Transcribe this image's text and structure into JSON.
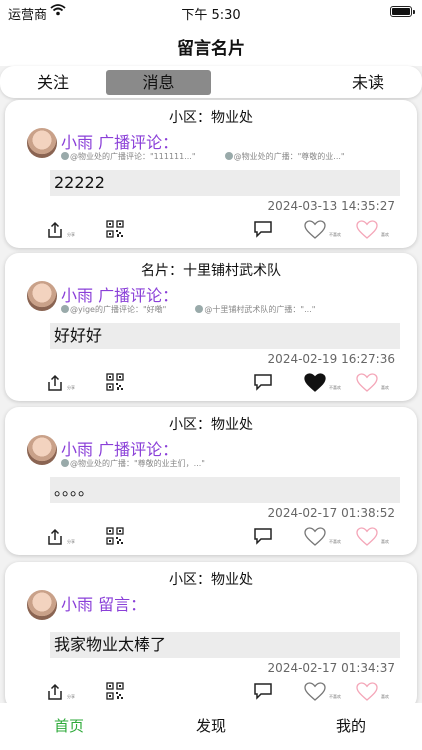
{
  "status_bar": {
    "carrier": "运营商",
    "time": "下午 5:30",
    "wifi_icon": "wifi-icon",
    "battery_icon": "battery-icon"
  },
  "nav": {
    "title": "留言名片"
  },
  "segments": {
    "follow": "关注",
    "messages": "消息",
    "unread": "未读",
    "selected": "消息"
  },
  "cards": [
    {
      "title": "小区：物业处",
      "author": "小雨 广播评论：",
      "quote_left": "@物业处的广播评论：\"111111...\"",
      "quote_right": "@物业处的广播：\"尊敬的业...\"",
      "content": "22222",
      "timestamp": "2024-03-13 14:35:27",
      "share_label": "分享",
      "like_label": "不喜欢",
      "fav_label": "喜欢",
      "liked": false
    },
    {
      "title": "名片：十里铺村武术队",
      "author": "小雨 广播评论：",
      "quote_left": "@yige的广播评论：\"好嘞\"",
      "quote_right": "@十里铺村武术队的广播：\"...\"",
      "content": "好好好",
      "timestamp": "2024-02-19 16:27:36",
      "share_label": "分享",
      "like_label": "不喜欢",
      "fav_label": "喜欢",
      "liked": true
    },
    {
      "title": "小区：物业处",
      "author": "小雨 广播评论：",
      "quote_left": "@物业处的广播：\"尊敬的业主们，...\"",
      "quote_right": "",
      "content": "。。。。",
      "timestamp": "2024-02-17 01:38:52",
      "share_label": "分享",
      "like_label": "不喜欢",
      "fav_label": "喜欢",
      "liked": false
    },
    {
      "title": "小区：物业处",
      "author": "小雨 留言：",
      "quote_left": "",
      "quote_right": "",
      "content": "我家物业太棒了",
      "timestamp": "2024-02-17 01:34:37",
      "share_label": "分享",
      "like_label": "不喜欢",
      "fav_label": "喜欢",
      "liked": false
    }
  ],
  "tabs": {
    "home": "首页",
    "discover": "发现",
    "mine": "我的",
    "active": "首页"
  },
  "colors": {
    "accent_green": "#2eaa3a",
    "author_purple": "#8a3fd8",
    "heart_pink": "#f4a6b8"
  }
}
